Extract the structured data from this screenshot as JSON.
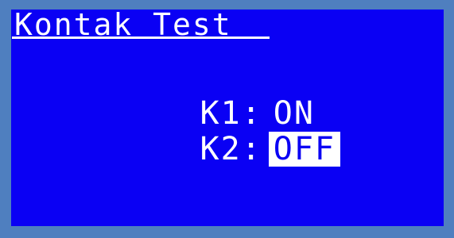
{
  "screen": {
    "title": "Kontak Test",
    "items": [
      {
        "label": "K1:",
        "value": "ON",
        "highlighted": false
      },
      {
        "label": "K2:",
        "value": "OFF",
        "highlighted": true
      }
    ]
  },
  "colors": {
    "frame": "#4f7fbf",
    "screen_background": "#0a00f4",
    "text": "#ffffff",
    "highlight_background": "#ffffff",
    "highlight_text": "#0a00f4"
  }
}
